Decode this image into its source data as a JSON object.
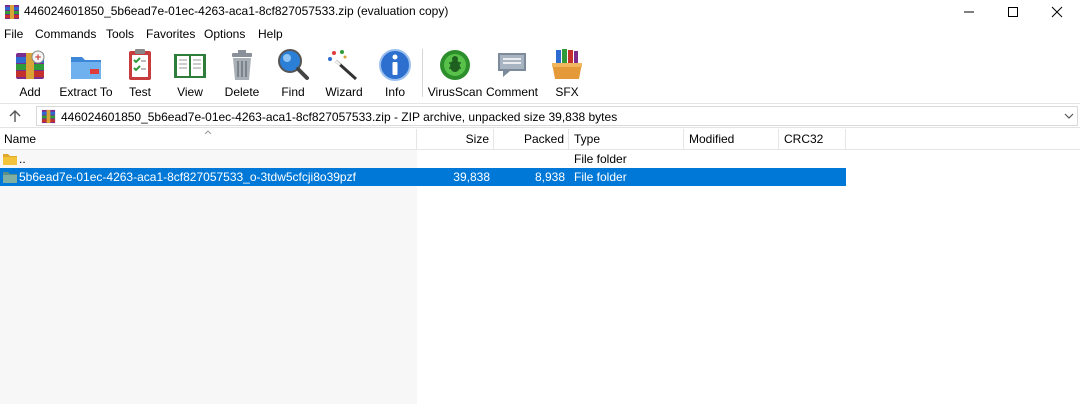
{
  "window": {
    "title": "446024601850_5b6ead7e-01ec-4263-aca1-8cf827057533.zip (evaluation copy)"
  },
  "menu": [
    "File",
    "Commands",
    "Tools",
    "Favorites",
    "Options",
    "Help"
  ],
  "toolbar": [
    {
      "label": "Add",
      "icon": "add-archive-icon"
    },
    {
      "label": "Extract To",
      "icon": "extract-folder-icon"
    },
    {
      "label": "Test",
      "icon": "test-clipboard-icon"
    },
    {
      "label": "View",
      "icon": "view-book-icon"
    },
    {
      "label": "Delete",
      "icon": "trash-bin-icon"
    },
    {
      "label": "Find",
      "icon": "magnifier-icon"
    },
    {
      "label": "Wizard",
      "icon": "magic-wand-icon"
    },
    {
      "label": "Info",
      "icon": "info-icon"
    },
    {
      "label": "VirusScan",
      "icon": "virus-bug-icon"
    },
    {
      "label": "Comment",
      "icon": "speech-bubble-icon"
    },
    {
      "label": "SFX",
      "icon": "sfx-package-icon"
    }
  ],
  "address": {
    "text": "446024601850_5b6ead7e-01ec-4263-aca1-8cf827057533.zip - ZIP archive, unpacked size 39,838 bytes"
  },
  "columns": [
    "Name",
    "Size",
    "Packed",
    "Type",
    "Modified",
    "CRC32"
  ],
  "rows": [
    {
      "name": "..",
      "size": "",
      "packed": "",
      "type": "File folder",
      "modified": "",
      "crc": "",
      "selected": false
    },
    {
      "name": "5b6ead7e-01ec-4263-aca1-8cf827057533_o-3tdw5cfcji8o39pzf",
      "size": "39,838",
      "packed": "8,938",
      "type": "File folder",
      "modified": "",
      "crc": "",
      "selected": true
    }
  ],
  "colors": {
    "selection": "#0078d7",
    "folder": "#f3c33b"
  }
}
